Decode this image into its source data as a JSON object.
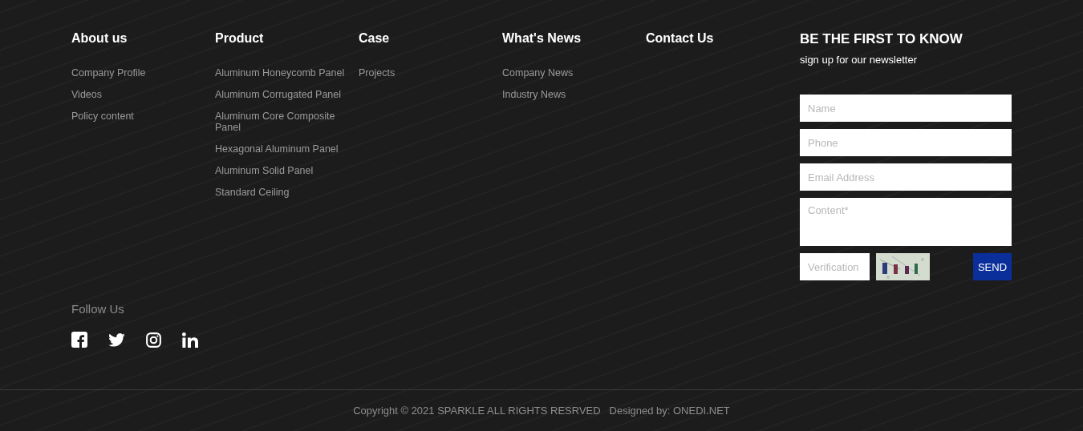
{
  "columns": [
    {
      "title": "About us",
      "links": [
        "Company Profile",
        "Videos",
        "Policy content"
      ]
    },
    {
      "title": "Product",
      "links": [
        "Aluminum Honeycomb Panel",
        "Aluminum Corrugated Panel",
        "Aluminum Core Composite Panel",
        "Hexagonal Aluminum Panel",
        "Aluminum Solid Panel",
        "Standard Ceiling"
      ]
    },
    {
      "title": "Case",
      "links": [
        "Projects"
      ]
    },
    {
      "title": "What's News",
      "links": [
        "Company News",
        "Industry News"
      ]
    },
    {
      "title": "Contact Us"
    }
  ],
  "newsletter": {
    "title": "BE THE FIRST TO KNOW",
    "subtitle": "sign up for our newsletter",
    "fields": [
      {
        "kind": "input",
        "placeholder": "Name"
      },
      {
        "kind": "input",
        "placeholder": "Phone"
      },
      {
        "kind": "input",
        "placeholder": "Email Address"
      },
      {
        "kind": "textarea",
        "placeholder": "Content*"
      }
    ],
    "verification": {
      "placeholder": "Verification"
    },
    "button": "SEND"
  },
  "follow": {
    "title": "Follow Us",
    "icons": [
      {
        "kind": "facebook"
      },
      {
        "kind": "twitter"
      },
      {
        "kind": "instagram"
      },
      {
        "kind": "linkedin"
      }
    ]
  },
  "copyright": "Copyright © 2021 SPARKLE ALL RIGHTS RESRVED   Designed by: ONEDI.NET"
}
